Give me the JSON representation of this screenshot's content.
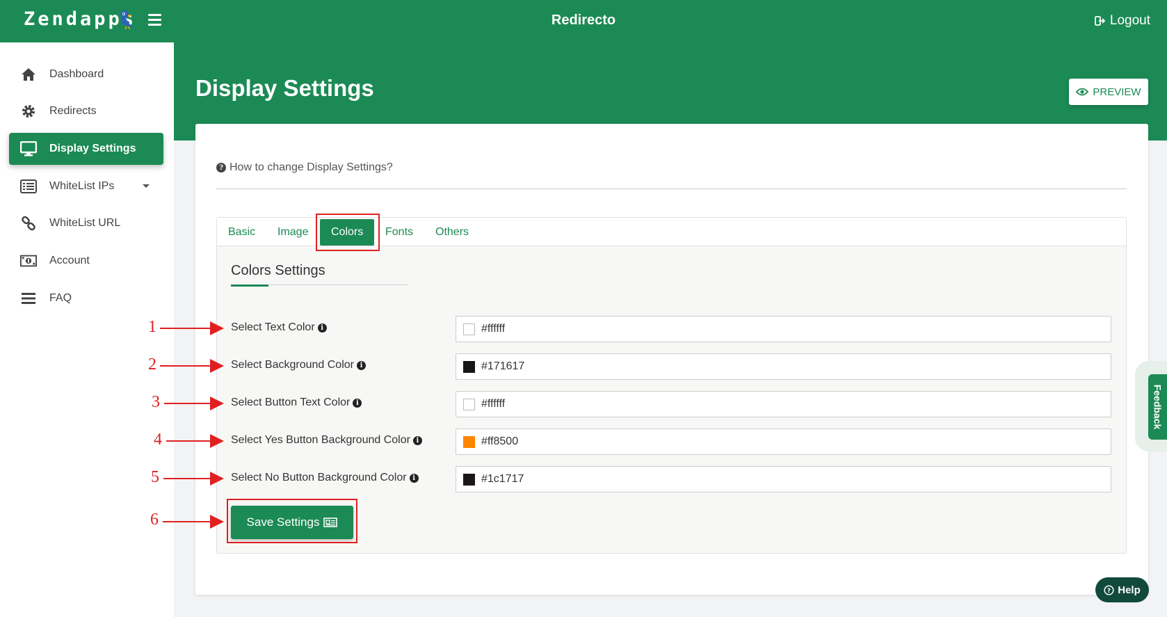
{
  "header": {
    "logo_text": "Zendapps",
    "app_title": "Redirecto",
    "logout_label": "Logout"
  },
  "sidebar": {
    "items": [
      {
        "label": "Dashboard",
        "icon": "home-icon"
      },
      {
        "label": "Redirects",
        "icon": "gear-icon"
      },
      {
        "label": "Display Settings",
        "icon": "monitor-icon",
        "active": true
      },
      {
        "label": "WhiteList IPs",
        "icon": "list-icon",
        "has_dropdown": true
      },
      {
        "label": "WhiteList URL",
        "icon": "link-icon"
      },
      {
        "label": "Account",
        "icon": "money-icon"
      },
      {
        "label": "FAQ",
        "icon": "bars-icon"
      }
    ]
  },
  "main": {
    "page_title": "Display Settings",
    "preview_label": "PREVIEW",
    "howto_label": "How to change Display Settings?",
    "tabs": [
      "Basic",
      "Image",
      "Colors",
      "Fonts",
      "Others"
    ],
    "active_tab": "Colors",
    "section_title": "Colors Settings",
    "fields": [
      {
        "label": "Select Text Color",
        "value": "#ffffff",
        "swatch": "#ffffff"
      },
      {
        "label": "Select Background Color",
        "value": "#171617",
        "swatch": "#171617"
      },
      {
        "label": "Select Button Text Color",
        "value": "#ffffff",
        "swatch": "#ffffff"
      },
      {
        "label": "Select Yes Button Background Color",
        "value": "#ff8500",
        "swatch": "#ff8500"
      },
      {
        "label": "Select No Button Background Color",
        "value": "#1c1717",
        "swatch": "#1c1717"
      }
    ],
    "save_label": "Save Settings"
  },
  "annotations": {
    "numbers": [
      "1",
      "2",
      "3",
      "4",
      "5",
      "6"
    ]
  },
  "widgets": {
    "feedback_label": "Feedback",
    "help_label": "Help"
  },
  "colors": {
    "brand": "#1c8a55",
    "annotation_red": "#e02020"
  }
}
